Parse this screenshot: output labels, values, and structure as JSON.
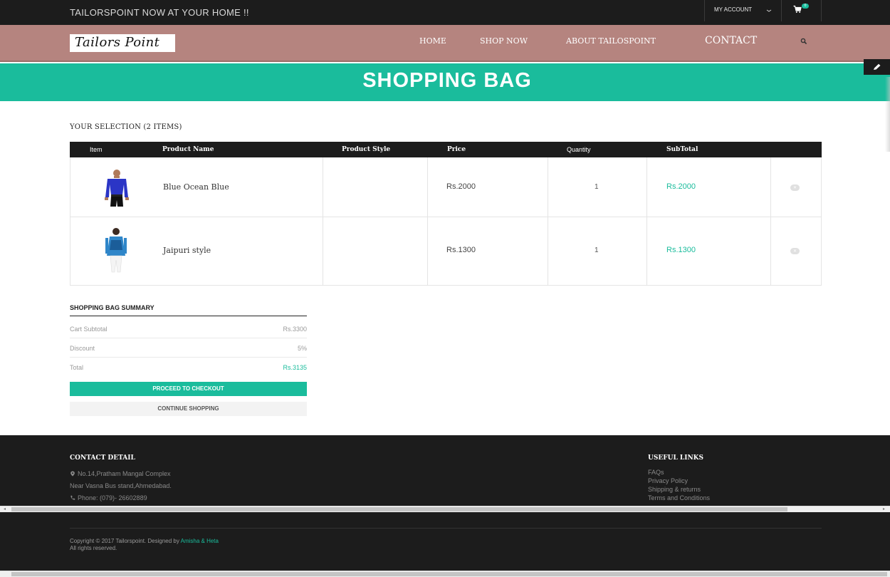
{
  "topbar": {
    "tagline": "TAILORSPOINT NOW AT YOUR HOME !!",
    "account_label": "MY ACCOUNT",
    "cart_count": "0"
  },
  "header": {
    "logo_text": "Tailors Point",
    "nav": [
      "HOME",
      "SHOP NOW",
      "ABOUT TAILOSPOINT",
      "CONTACT"
    ]
  },
  "banner": {
    "title": "SHOPPING BAG"
  },
  "selection_heading": "YOUR SELECTION (2 ITEMS)",
  "table": {
    "columns": [
      "Item",
      "Product Name",
      "Product Style",
      "Price",
      "Quantity",
      "SubTotal"
    ],
    "rows": [
      {
        "name": "Blue Ocean Blue",
        "style": "",
        "price": "Rs.2000",
        "quantity": "1",
        "subtotal": "Rs.2000"
      },
      {
        "name": "Jaipuri style",
        "style": "",
        "price": "Rs.1300",
        "quantity": "1",
        "subtotal": "Rs.1300"
      }
    ]
  },
  "summary": {
    "title": "SHOPPING BAG SUMMARY",
    "rows": [
      {
        "label": "Cart Subtotal",
        "value": "Rs.3300"
      },
      {
        "label": "Discount",
        "value": "5%"
      },
      {
        "label": "Total",
        "value": "Rs.3135"
      }
    ],
    "checkout_label": "PROCEED TO CHECKOUT",
    "continue_label": "CONTINUE SHOPPING"
  },
  "footer": {
    "contact_title": "CONTACT DETAIL",
    "address_line1": "No.14,Pratham Mangal Complex",
    "address_line2": "Near Vasna Bus stand,Ahmedabad.",
    "phone": "Phone: (079)- 26602889",
    "links_title": "USEFUL LINKS",
    "links": [
      "FAQs",
      "Privacy Policy",
      "Shipping & returns",
      "Terms and Conditions"
    ],
    "copyright": "Copyright © 2017 Tailorspoint. Designed by",
    "designer": "Amisha & Heta",
    "rights": "All rights reserved."
  },
  "colors": {
    "accent": "#1abc9c",
    "header_bg": "#b5847f",
    "dark": "#1c1c1c"
  }
}
